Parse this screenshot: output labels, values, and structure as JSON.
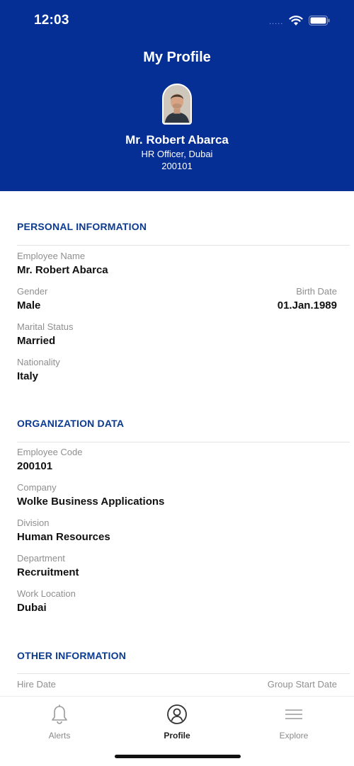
{
  "status_bar": {
    "time": "12:03",
    "signal": "....."
  },
  "header": {
    "title": "My Profile",
    "name": "Mr. Robert Abarca",
    "role": "HR Officer, Dubai",
    "employee_id": "200101"
  },
  "sections": {
    "personal": {
      "title": "PERSONAL INFORMATION",
      "employee_name_label": "Employee Name",
      "employee_name": "Mr. Robert Abarca",
      "gender_label": "Gender",
      "gender": "Male",
      "birth_date_label": "Birth Date",
      "birth_date": "01.Jan.1989",
      "marital_status_label": "Marital Status",
      "marital_status": "Married",
      "nationality_label": "Nationality",
      "nationality": "Italy"
    },
    "organization": {
      "title": "ORGANIZATION DATA",
      "employee_code_label": "Employee Code",
      "employee_code": "200101",
      "company_label": "Company",
      "company": "Wolke Business Applications",
      "division_label": "Division",
      "division": "Human Resources",
      "department_label": "Department",
      "department": "Recruitment",
      "work_location_label": "Work Location",
      "work_location": "Dubai"
    },
    "other": {
      "title": "OTHER INFORMATION",
      "hire_date_label": "Hire Date",
      "group_start_date_label": "Group Start Date"
    }
  },
  "tabbar": {
    "tabs": [
      {
        "label": "Alerts",
        "icon": "bell-icon"
      },
      {
        "label": "Profile",
        "icon": "profile-icon"
      },
      {
        "label": "Explore",
        "icon": "menu-icon"
      }
    ],
    "active": "Profile"
  },
  "colors": {
    "header_bg": "#062f96",
    "section_title": "#0b3a91"
  }
}
